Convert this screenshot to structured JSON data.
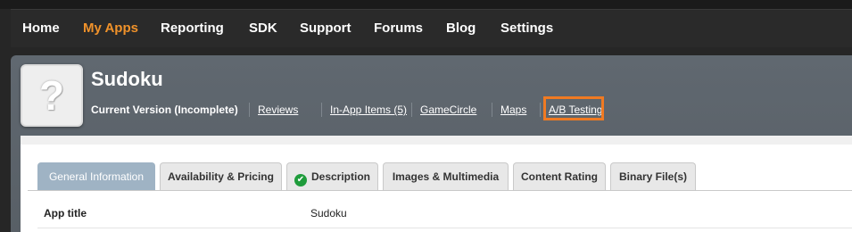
{
  "top_nav": {
    "items": [
      {
        "label": "Home",
        "active": false
      },
      {
        "label": "My Apps",
        "active": true
      },
      {
        "label": "Reporting",
        "active": false
      },
      {
        "label": "SDK",
        "active": false
      },
      {
        "label": "Support",
        "active": false
      },
      {
        "label": "Forums",
        "active": false
      },
      {
        "label": "Blog",
        "active": false
      },
      {
        "label": "Settings",
        "active": false
      }
    ]
  },
  "app": {
    "icon_glyph": "?",
    "name": "Sudoku",
    "current_version": "Current Version (Incomplete)",
    "links": [
      "Reviews",
      "In-App Items (5)",
      "GameCircle",
      "Maps",
      "A/B Testing"
    ]
  },
  "tabs": [
    {
      "label": "General Information",
      "active": true
    },
    {
      "label": "Availability & Pricing",
      "active": false
    },
    {
      "label": "Description",
      "active": false,
      "icon": "check-circle-icon"
    },
    {
      "label": "Images & Multimedia",
      "active": false
    },
    {
      "label": "Content Rating",
      "active": false
    },
    {
      "label": "Binary File(s)",
      "active": false
    }
  ],
  "fields": [
    {
      "label": "App title",
      "value": "Sudoku"
    }
  ],
  "colors": {
    "nav_active": "#f0922a",
    "highlight": "#f07a22",
    "tab_active": "#9fb3c4",
    "check": "#1f9c3c"
  }
}
